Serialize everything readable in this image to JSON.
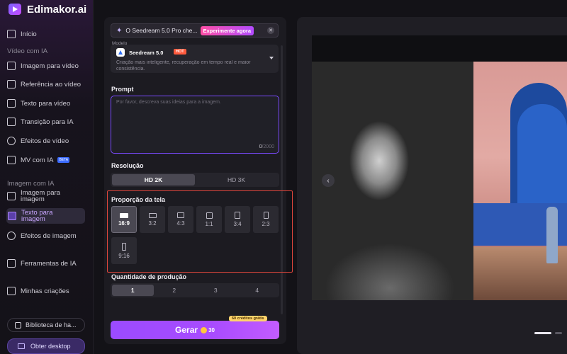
{
  "brand": {
    "name": "Edimakor.ai"
  },
  "sidebar": {
    "home": "Início",
    "video_section": "Vídeo com IA",
    "video_items": [
      "Imagem para vídeo",
      "Referência ao vídeo",
      "Texto para vídeo",
      "Transição para IA",
      "Efeitos de vídeo",
      "MV com IA"
    ],
    "mv_badge": "BETA",
    "image_section": "Imagem com IA",
    "image_to_image": "Imagem para imagem",
    "text_to_image": "Texto para imagem",
    "image_effects": "Efeitos de imagem",
    "ai_tools": "Ferramentas de IA",
    "my_creations": "Minhas criações",
    "library": "Biblioteca de ha...",
    "get_desktop": "Obter desktop"
  },
  "panel": {
    "banner_text": "O Seedream 5.0 Pro che...",
    "banner_cta": "Experimente agora",
    "model_label": "Modelo",
    "model_name": "Seedream 5.0",
    "model_badge": "HOT",
    "model_desc": "Criação mais inteligente, recuperação em tempo real e maior consistência.",
    "prompt_label": "Prompt",
    "prompt_placeholder": "Por favor, descreva suas ideias para a imagem.",
    "prompt_count_current": "0",
    "prompt_count_max": "/2000",
    "resolution_label": "Resolução",
    "resolutions": [
      "HD 2K",
      "HD 3K"
    ],
    "resolution_selected": "HD 2K",
    "ratio_label": "Proporção da tela",
    "ratios": [
      "16:9",
      "3:2",
      "4:3",
      "1:1",
      "3:4",
      "2:3",
      "9:16"
    ],
    "ratio_selected": "16:9",
    "quantity_label": "Quantidade de produção",
    "quantities": [
      "1",
      "2",
      "3",
      "4"
    ],
    "quantity_selected": "1",
    "generate_label": "Gerar",
    "generate_cost": "30",
    "credit_tag": "60 créditos grátis"
  },
  "colors": {
    "accent": "#9b4bff",
    "highlight": "#e0463c",
    "hot": "#ff5a3d",
    "cta": "#ff4fa6"
  },
  "icons": [
    "home-icon",
    "image-video-icon",
    "reference-icon",
    "text-video-icon",
    "transition-icon",
    "effects-icon",
    "mv-icon",
    "image-image-icon",
    "text-image-icon",
    "image-effects-icon",
    "tools-icon",
    "folder-icon",
    "library-icon",
    "desktop-icon",
    "spark-icon",
    "close-icon",
    "chevron-down-icon",
    "coin-icon",
    "arrow-left-icon"
  ]
}
